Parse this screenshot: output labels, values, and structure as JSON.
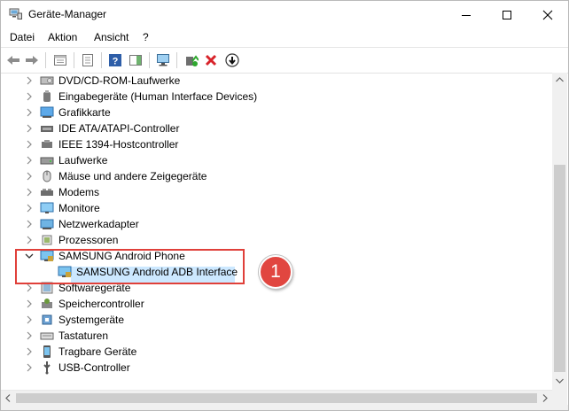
{
  "window": {
    "title": "Geräte-Manager"
  },
  "menu": [
    "Datei",
    "Aktion",
    "Ansicht",
    "?"
  ],
  "toolbar": [
    {
      "name": "back-arrow-icon"
    },
    {
      "name": "forward-arrow-icon"
    },
    {
      "name": "properties-icon"
    },
    {
      "name": "list-view-icon"
    },
    {
      "name": "help-icon"
    },
    {
      "name": "action-pane-icon"
    },
    {
      "name": "monitor-scan-icon"
    },
    {
      "name": "update-driver-icon"
    },
    {
      "name": "uninstall-x-icon"
    },
    {
      "name": "download-arrow-icon"
    }
  ],
  "tree": [
    {
      "label": "DVD/CD-ROM-Laufwerke",
      "icon": "dvd-drive-icon",
      "expanded": false
    },
    {
      "label": "Eingabegeräte (Human Interface Devices)",
      "icon": "hid-icon",
      "expanded": false
    },
    {
      "label": "Grafikkarte",
      "icon": "display-adapter-icon",
      "expanded": false
    },
    {
      "label": "IDE ATA/ATAPI-Controller",
      "icon": "ide-controller-icon",
      "expanded": false
    },
    {
      "label": "IEEE 1394-Hostcontroller",
      "icon": "ieee1394-icon",
      "expanded": false
    },
    {
      "label": "Laufwerke",
      "icon": "disk-drive-icon",
      "expanded": false
    },
    {
      "label": "Mäuse und andere Zeigegeräte",
      "icon": "mouse-icon",
      "expanded": false
    },
    {
      "label": "Modems",
      "icon": "modem-icon",
      "expanded": false
    },
    {
      "label": "Monitore",
      "icon": "monitor-icon",
      "expanded": false
    },
    {
      "label": "Netzwerkadapter",
      "icon": "network-adapter-icon",
      "expanded": false
    },
    {
      "label": "Prozessoren",
      "icon": "processor-icon",
      "expanded": false
    },
    {
      "label": "SAMSUNG Android Phone",
      "icon": "android-phone-icon",
      "expanded": true
    },
    {
      "label": "SAMSUNG Android ADB Interface",
      "icon": "adb-interface-icon",
      "child": true,
      "selected": true
    },
    {
      "label": "Softwaregeräte",
      "icon": "software-device-icon",
      "expanded": false
    },
    {
      "label": "Speichercontroller",
      "icon": "storage-controller-icon",
      "expanded": false
    },
    {
      "label": "Systemgeräte",
      "icon": "system-device-icon",
      "expanded": false
    },
    {
      "label": "Tastaturen",
      "icon": "keyboard-icon",
      "expanded": false
    },
    {
      "label": "Tragbare Geräte",
      "icon": "portable-device-icon",
      "expanded": false
    },
    {
      "label": "USB-Controller",
      "icon": "usb-controller-icon",
      "expanded": false
    }
  ],
  "annotation": {
    "number": "1"
  },
  "colors": {
    "highlight": "#e0403a",
    "selection": "#cce8ff",
    "callout": "#e14640"
  }
}
